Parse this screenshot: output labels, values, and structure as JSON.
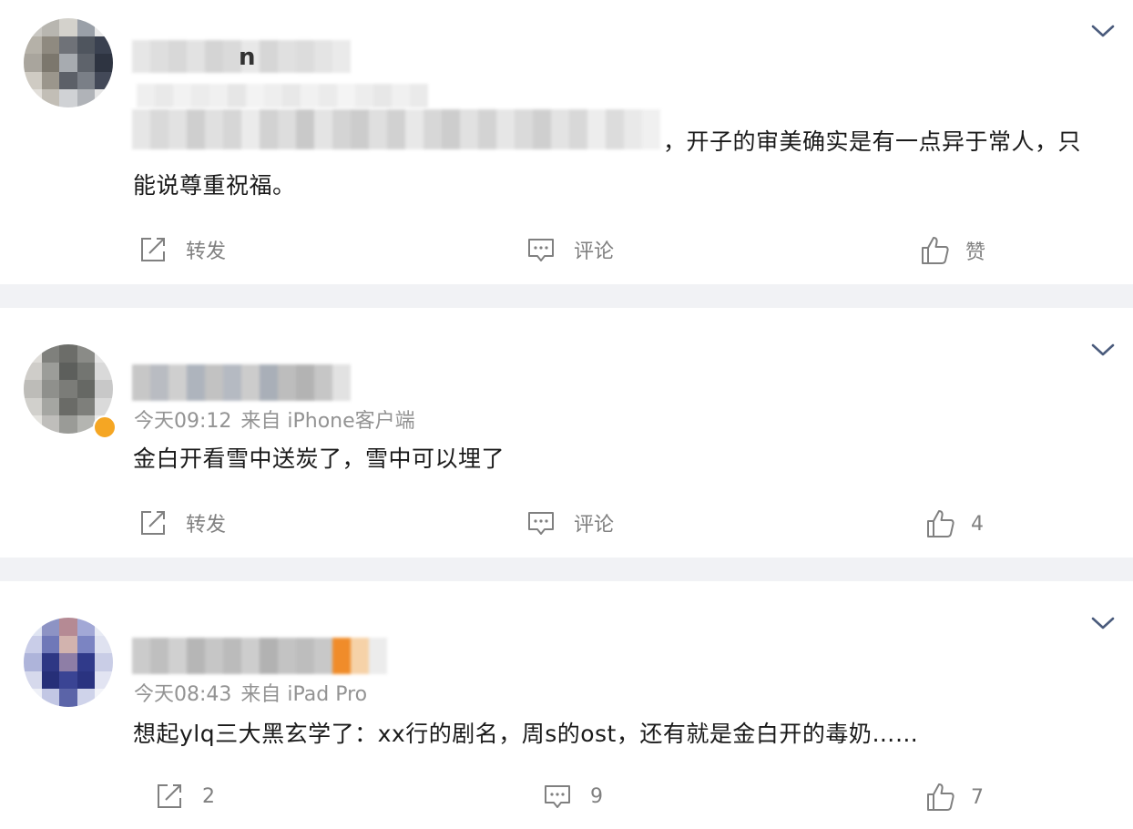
{
  "comments": [
    {
      "username_suffix": "n",
      "time": "",
      "source": "",
      "text_line1_visible": "，开子的审美确实是有一点异于常人，只",
      "text_line2": "能说尊重祝福。",
      "actions": {
        "repost": "转发",
        "comment": "评论",
        "like": "赞"
      }
    },
    {
      "time": "今天09:12",
      "source": "来自 iPhone客户端",
      "text": "金白开看雪中送炭了，雪中可以埋了",
      "actions": {
        "repost": "转发",
        "comment": "评论",
        "like": "4"
      }
    },
    {
      "time": "今天08:43",
      "source": "来自 iPad Pro",
      "text": "想起ylq三大黑玄学了：xx行的剧名，周s的ost，还有就是金白开的毒奶……",
      "actions": {
        "repost": "2",
        "comment": "9",
        "like": "7"
      }
    }
  ],
  "icons": {
    "expand": "chevron-down-icon",
    "repost": "share-icon",
    "comment": "comment-icon",
    "like": "thumbs-up-icon",
    "vip_badge": "verified-badge-icon"
  },
  "colors": {
    "text_main": "#1a1a1a",
    "text_meta": "#939393",
    "action": "#808080",
    "separator": "#f1f2f5",
    "chevron": "#4a5b7c",
    "badge": "#f5a623"
  }
}
